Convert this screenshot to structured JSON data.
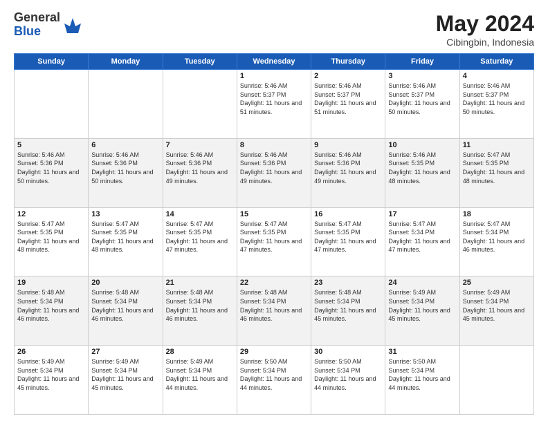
{
  "header": {
    "logo_general": "General",
    "logo_blue": "Blue",
    "month_title": "May 2024",
    "location": "Cibingbin, Indonesia"
  },
  "weekdays": [
    "Sunday",
    "Monday",
    "Tuesday",
    "Wednesday",
    "Thursday",
    "Friday",
    "Saturday"
  ],
  "weeks": [
    [
      {
        "day": "",
        "sunrise": "",
        "sunset": "",
        "daylight": ""
      },
      {
        "day": "",
        "sunrise": "",
        "sunset": "",
        "daylight": ""
      },
      {
        "day": "",
        "sunrise": "",
        "sunset": "",
        "daylight": ""
      },
      {
        "day": "1",
        "sunrise": "Sunrise: 5:46 AM",
        "sunset": "Sunset: 5:37 PM",
        "daylight": "Daylight: 11 hours and 51 minutes."
      },
      {
        "day": "2",
        "sunrise": "Sunrise: 5:46 AM",
        "sunset": "Sunset: 5:37 PM",
        "daylight": "Daylight: 11 hours and 51 minutes."
      },
      {
        "day": "3",
        "sunrise": "Sunrise: 5:46 AM",
        "sunset": "Sunset: 5:37 PM",
        "daylight": "Daylight: 11 hours and 50 minutes."
      },
      {
        "day": "4",
        "sunrise": "Sunrise: 5:46 AM",
        "sunset": "Sunset: 5:37 PM",
        "daylight": "Daylight: 11 hours and 50 minutes."
      }
    ],
    [
      {
        "day": "5",
        "sunrise": "Sunrise: 5:46 AM",
        "sunset": "Sunset: 5:36 PM",
        "daylight": "Daylight: 11 hours and 50 minutes."
      },
      {
        "day": "6",
        "sunrise": "Sunrise: 5:46 AM",
        "sunset": "Sunset: 5:36 PM",
        "daylight": "Daylight: 11 hours and 50 minutes."
      },
      {
        "day": "7",
        "sunrise": "Sunrise: 5:46 AM",
        "sunset": "Sunset: 5:36 PM",
        "daylight": "Daylight: 11 hours and 49 minutes."
      },
      {
        "day": "8",
        "sunrise": "Sunrise: 5:46 AM",
        "sunset": "Sunset: 5:36 PM",
        "daylight": "Daylight: 11 hours and 49 minutes."
      },
      {
        "day": "9",
        "sunrise": "Sunrise: 5:46 AM",
        "sunset": "Sunset: 5:36 PM",
        "daylight": "Daylight: 11 hours and 49 minutes."
      },
      {
        "day": "10",
        "sunrise": "Sunrise: 5:46 AM",
        "sunset": "Sunset: 5:35 PM",
        "daylight": "Daylight: 11 hours and 48 minutes."
      },
      {
        "day": "11",
        "sunrise": "Sunrise: 5:47 AM",
        "sunset": "Sunset: 5:35 PM",
        "daylight": "Daylight: 11 hours and 48 minutes."
      }
    ],
    [
      {
        "day": "12",
        "sunrise": "Sunrise: 5:47 AM",
        "sunset": "Sunset: 5:35 PM",
        "daylight": "Daylight: 11 hours and 48 minutes."
      },
      {
        "day": "13",
        "sunrise": "Sunrise: 5:47 AM",
        "sunset": "Sunset: 5:35 PM",
        "daylight": "Daylight: 11 hours and 48 minutes."
      },
      {
        "day": "14",
        "sunrise": "Sunrise: 5:47 AM",
        "sunset": "Sunset: 5:35 PM",
        "daylight": "Daylight: 11 hours and 47 minutes."
      },
      {
        "day": "15",
        "sunrise": "Sunrise: 5:47 AM",
        "sunset": "Sunset: 5:35 PM",
        "daylight": "Daylight: 11 hours and 47 minutes."
      },
      {
        "day": "16",
        "sunrise": "Sunrise: 5:47 AM",
        "sunset": "Sunset: 5:35 PM",
        "daylight": "Daylight: 11 hours and 47 minutes."
      },
      {
        "day": "17",
        "sunrise": "Sunrise: 5:47 AM",
        "sunset": "Sunset: 5:34 PM",
        "daylight": "Daylight: 11 hours and 47 minutes."
      },
      {
        "day": "18",
        "sunrise": "Sunrise: 5:47 AM",
        "sunset": "Sunset: 5:34 PM",
        "daylight": "Daylight: 11 hours and 46 minutes."
      }
    ],
    [
      {
        "day": "19",
        "sunrise": "Sunrise: 5:48 AM",
        "sunset": "Sunset: 5:34 PM",
        "daylight": "Daylight: 11 hours and 46 minutes."
      },
      {
        "day": "20",
        "sunrise": "Sunrise: 5:48 AM",
        "sunset": "Sunset: 5:34 PM",
        "daylight": "Daylight: 11 hours and 46 minutes."
      },
      {
        "day": "21",
        "sunrise": "Sunrise: 5:48 AM",
        "sunset": "Sunset: 5:34 PM",
        "daylight": "Daylight: 11 hours and 46 minutes."
      },
      {
        "day": "22",
        "sunrise": "Sunrise: 5:48 AM",
        "sunset": "Sunset: 5:34 PM",
        "daylight": "Daylight: 11 hours and 46 minutes."
      },
      {
        "day": "23",
        "sunrise": "Sunrise: 5:48 AM",
        "sunset": "Sunset: 5:34 PM",
        "daylight": "Daylight: 11 hours and 45 minutes."
      },
      {
        "day": "24",
        "sunrise": "Sunrise: 5:49 AM",
        "sunset": "Sunset: 5:34 PM",
        "daylight": "Daylight: 11 hours and 45 minutes."
      },
      {
        "day": "25",
        "sunrise": "Sunrise: 5:49 AM",
        "sunset": "Sunset: 5:34 PM",
        "daylight": "Daylight: 11 hours and 45 minutes."
      }
    ],
    [
      {
        "day": "26",
        "sunrise": "Sunrise: 5:49 AM",
        "sunset": "Sunset: 5:34 PM",
        "daylight": "Daylight: 11 hours and 45 minutes."
      },
      {
        "day": "27",
        "sunrise": "Sunrise: 5:49 AM",
        "sunset": "Sunset: 5:34 PM",
        "daylight": "Daylight: 11 hours and 45 minutes."
      },
      {
        "day": "28",
        "sunrise": "Sunrise: 5:49 AM",
        "sunset": "Sunset: 5:34 PM",
        "daylight": "Daylight: 11 hours and 44 minutes."
      },
      {
        "day": "29",
        "sunrise": "Sunrise: 5:50 AM",
        "sunset": "Sunset: 5:34 PM",
        "daylight": "Daylight: 11 hours and 44 minutes."
      },
      {
        "day": "30",
        "sunrise": "Sunrise: 5:50 AM",
        "sunset": "Sunset: 5:34 PM",
        "daylight": "Daylight: 11 hours and 44 minutes."
      },
      {
        "day": "31",
        "sunrise": "Sunrise: 5:50 AM",
        "sunset": "Sunset: 5:34 PM",
        "daylight": "Daylight: 11 hours and 44 minutes."
      },
      {
        "day": "",
        "sunrise": "",
        "sunset": "",
        "daylight": ""
      }
    ]
  ]
}
